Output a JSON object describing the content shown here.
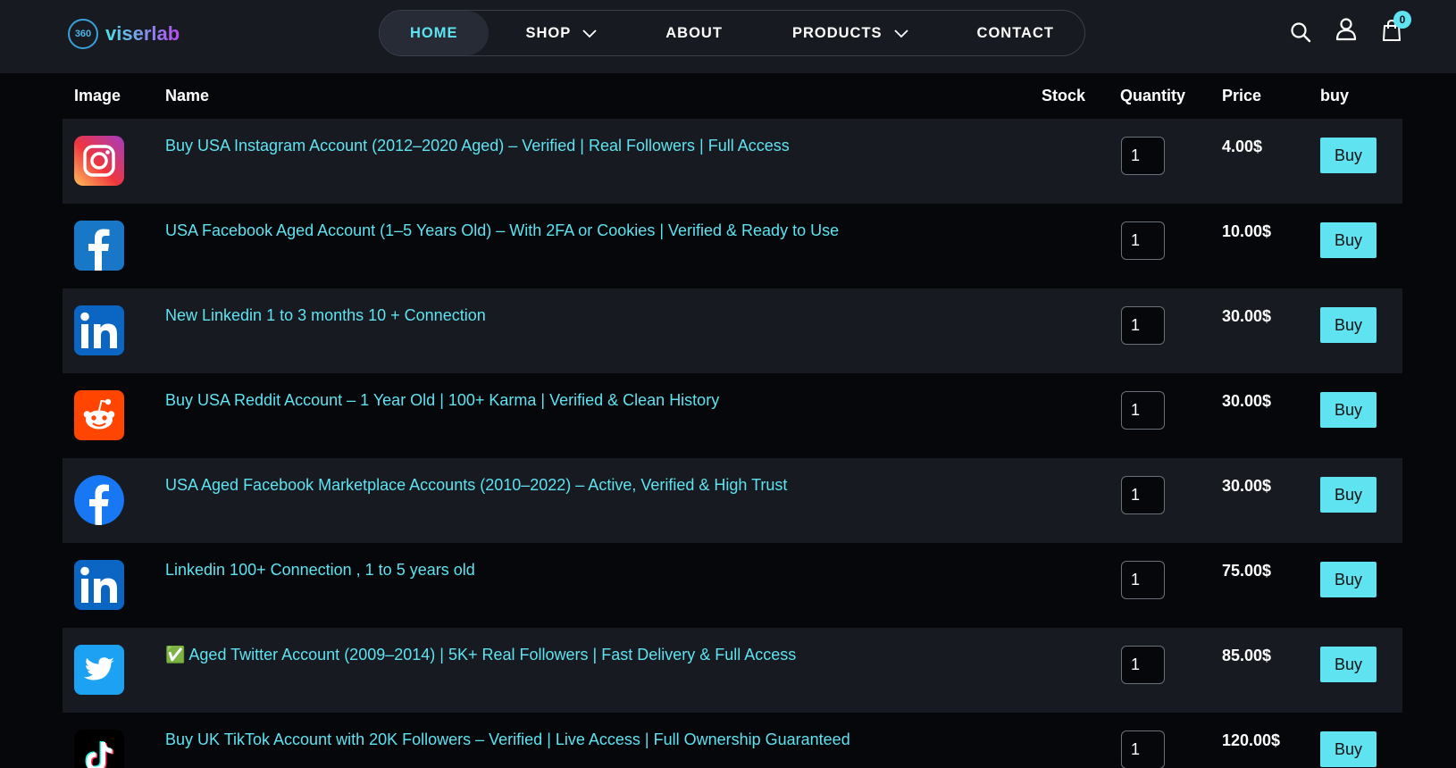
{
  "header": {
    "brand": "viserlab",
    "brand_badge": "360",
    "nav": [
      {
        "label": "HOME",
        "active": true
      },
      {
        "label": "SHOP",
        "dropdown": true
      },
      {
        "label": "ABOUT"
      },
      {
        "label": "PRODUCTS",
        "dropdown": true
      },
      {
        "label": "CONTACT"
      }
    ],
    "cart_count": "0",
    "icons": [
      "search-icon",
      "user-icon",
      "shopping-bag-icon"
    ]
  },
  "table": {
    "columns": {
      "image": "Image",
      "name": "Name",
      "stock": "Stock",
      "quantity": "Quantity",
      "price": "Price",
      "buy": "buy"
    },
    "buy_label": "Buy",
    "rows": [
      {
        "icon": "instagram-icon",
        "name": "Buy USA Instagram Account (2012–2020 Aged) – Verified | Real Followers | Full Access",
        "quantity": "1",
        "price": "4.00$"
      },
      {
        "icon": "facebook-icon",
        "name": "USA Facebook Aged Account (1–5 Years Old) – With 2FA or Cookies | Verified & Ready to Use",
        "quantity": "1",
        "price": "10.00$"
      },
      {
        "icon": "linkedin-icon",
        "name": "New Linkedin 1 to 3 months 10 + Connection",
        "quantity": "1",
        "price": "30.00$"
      },
      {
        "icon": "reddit-icon",
        "name": "Buy USA Reddit Account – 1 Year Old | 100+ Karma | Verified & Clean History",
        "quantity": "1",
        "price": "30.00$"
      },
      {
        "icon": "facebook-circle-icon",
        "name": "USA Aged Facebook Marketplace Accounts (2010–2022) – Active, Verified & High Trust",
        "quantity": "1",
        "price": "30.00$"
      },
      {
        "icon": "linkedin-icon",
        "name": "Linkedin 100+ Connection , 1 to 5 years old",
        "quantity": "1",
        "price": "75.00$"
      },
      {
        "icon": "twitter-icon",
        "name": "✅ Aged Twitter Account (2009–2014) | 5K+ Real Followers | Fast Delivery & Full Access",
        "quantity": "1",
        "price": "85.00$"
      },
      {
        "icon": "tiktok-icon",
        "name": "Buy UK TikTok Account with 20K Followers – Verified | Live Access | Full Ownership Guaranteed",
        "quantity": "1",
        "price": "120.00$"
      }
    ]
  },
  "colors": {
    "accent": "#5fe3f0",
    "header_bg": "#171a21",
    "page_bg": "#05070b",
    "row_alt_bg": "#171a21"
  }
}
